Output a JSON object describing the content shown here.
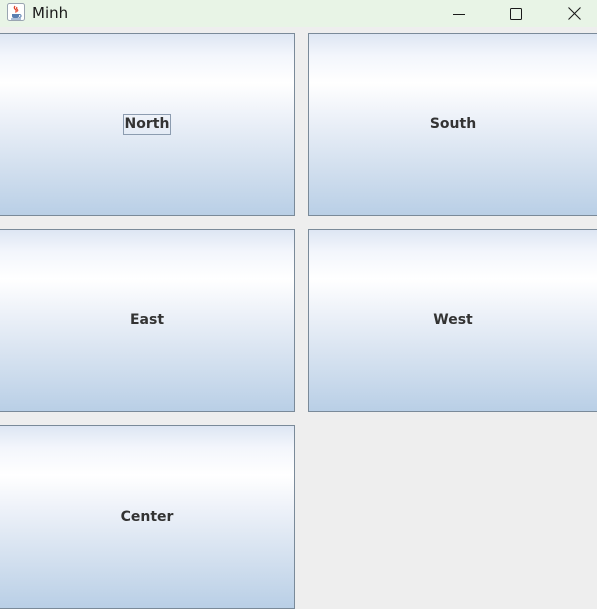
{
  "window": {
    "title": "Minh",
    "icon": "java-cup-icon",
    "controls": {
      "minimize": "minimize-icon",
      "maximize": "maximize-icon",
      "close": "close-icon"
    }
  },
  "buttons": {
    "north": "North",
    "south": "South",
    "east": "East",
    "west": "West",
    "center": "Center"
  },
  "focused_button": "North",
  "colors": {
    "titlebar": "#e8f4e6",
    "background": "#eeeeee",
    "button_border": "#7a8a99",
    "button_text": "#333333"
  }
}
